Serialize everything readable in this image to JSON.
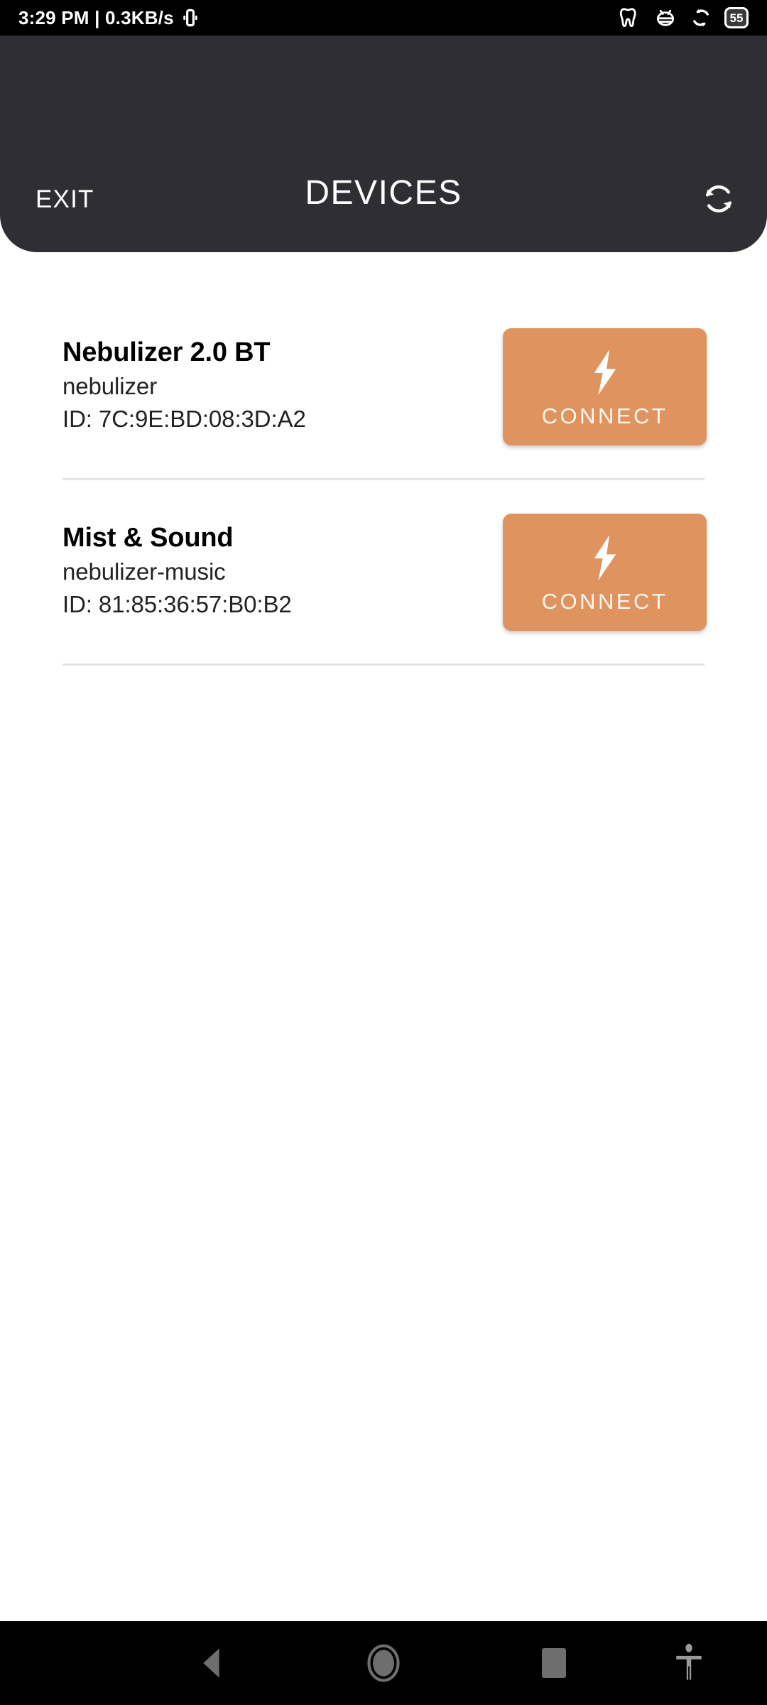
{
  "status_bar": {
    "time_and_rate": "3:29 PM | 0.3KB/s",
    "vibrate_icon": "vibrate-icon",
    "icons": [
      {
        "name": "tooth-icon"
      },
      {
        "name": "bug-icon"
      },
      {
        "name": "sync-icon"
      },
      {
        "name": "notification-count-badge",
        "label": "55"
      }
    ]
  },
  "app_bar": {
    "exit_label": "EXIT",
    "title": "DEVICES",
    "refresh_icon": "refresh-icon",
    "background_color": "#2e2e34"
  },
  "devices": [
    {
      "name": "Nebulizer 2.0 BT",
      "type": "nebulizer",
      "id": "ID: 7C:9E:BD:08:3D:A2",
      "action_label": "CONNECT",
      "action_icon": "lightning-bolt-icon"
    },
    {
      "name": "Mist & Sound",
      "type": "nebulizer-music",
      "id": "ID: 81:85:36:57:B0:B2",
      "action_label": "CONNECT",
      "action_icon": "lightning-bolt-icon"
    }
  ],
  "theme": {
    "accent_color": "#df945f",
    "header_color": "#2e2e34",
    "page_background": "#ffffff",
    "divider_color": "#e4e4e4"
  },
  "nav_bar": {
    "back_icon": "back-triangle-icon",
    "home_icon": "home-circle-icon",
    "recents_icon": "recents-square-icon",
    "accessibility_icon": "accessibility-icon"
  }
}
